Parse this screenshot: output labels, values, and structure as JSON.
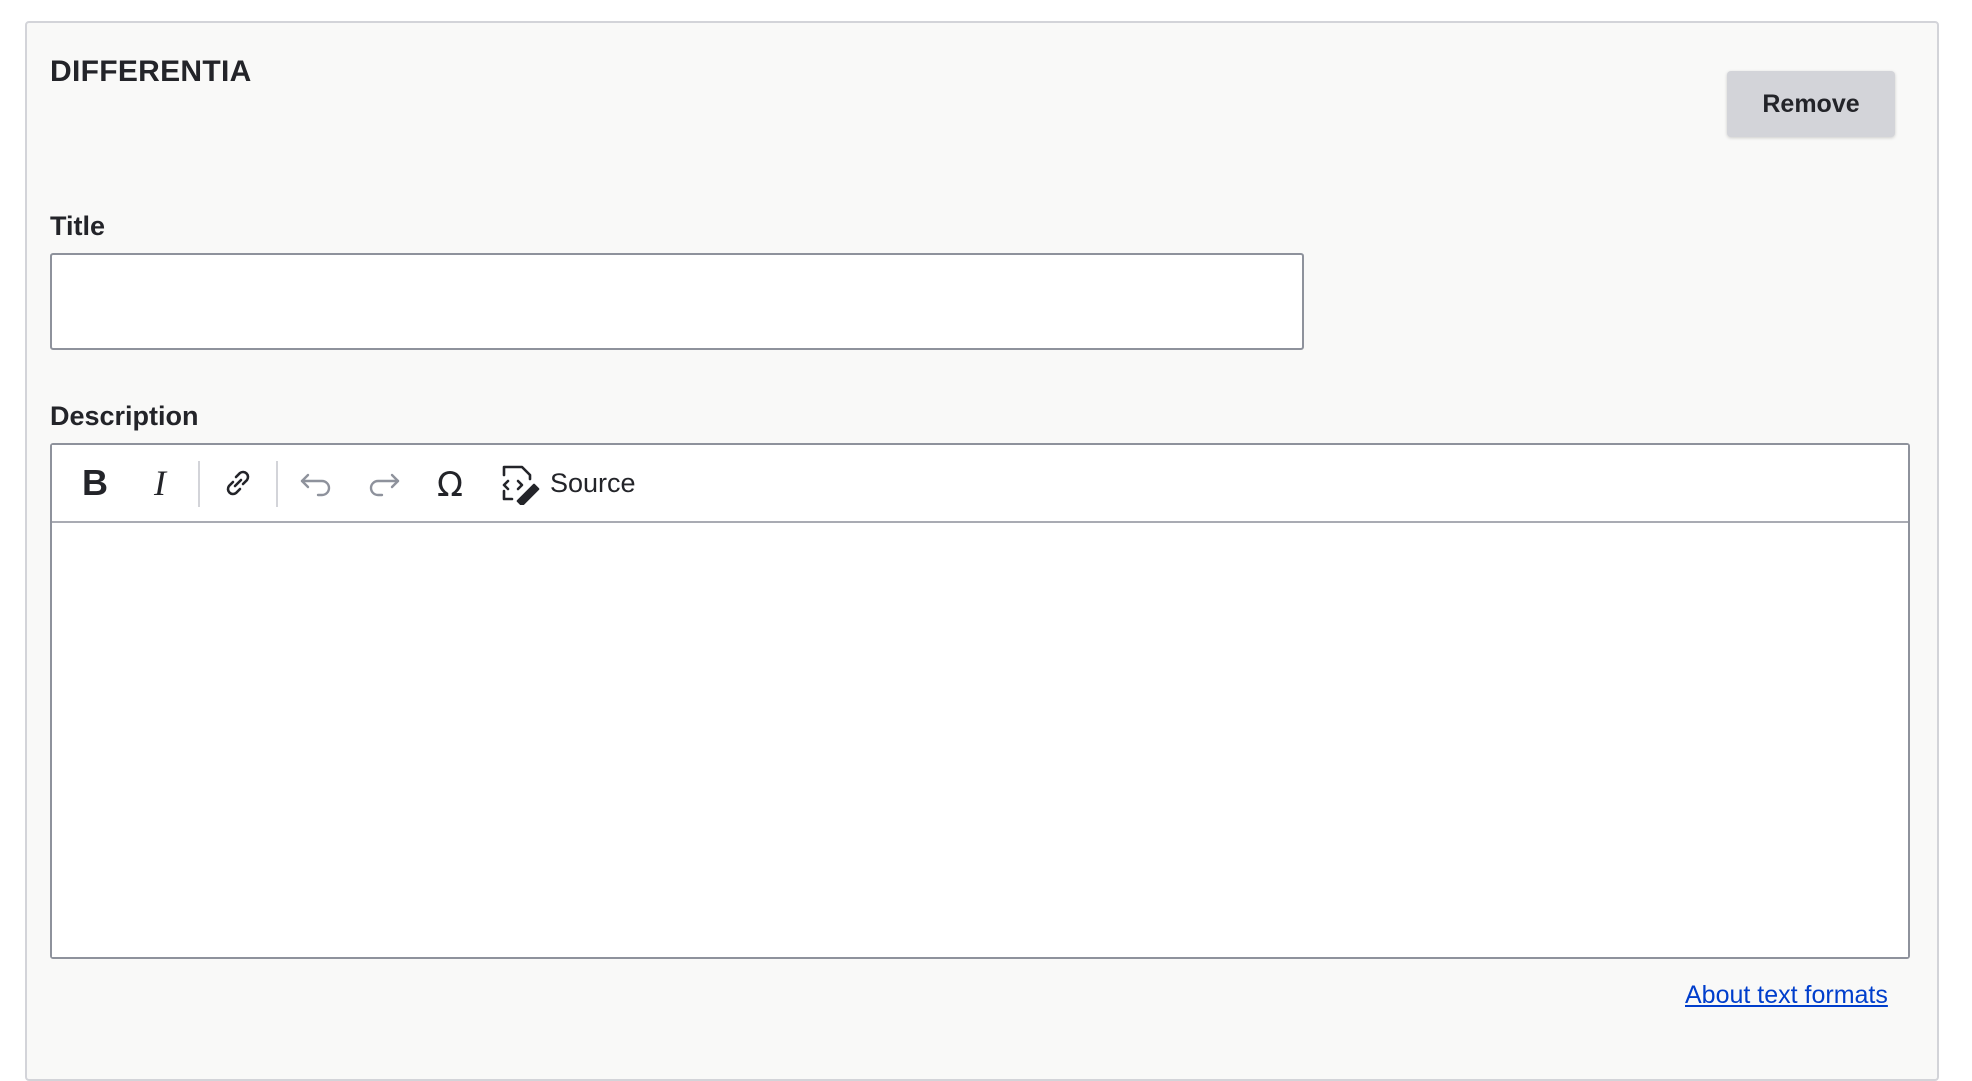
{
  "section": {
    "title": "DIFFERENTIA"
  },
  "actions": {
    "remove_label": "Remove"
  },
  "title_field": {
    "label": "Title",
    "value": "",
    "placeholder": ""
  },
  "description_field": {
    "label": "Description",
    "toolbar": {
      "bold_icon": "bold-icon",
      "italic_icon": "italic-icon",
      "link_icon": "link-icon",
      "undo_icon": "undo-icon",
      "redo_icon": "redo-icon",
      "special_chars_icon": "omega-icon",
      "source_icon": "source-editing-icon",
      "source_label": "Source"
    },
    "content": ""
  },
  "footer": {
    "about_link": "About text formats"
  },
  "colors": {
    "panel_bg": "#f9f9f8",
    "button_bg": "#d3d4d9",
    "link": "#003ecc",
    "text": "#232429",
    "border": "#8e929c"
  }
}
